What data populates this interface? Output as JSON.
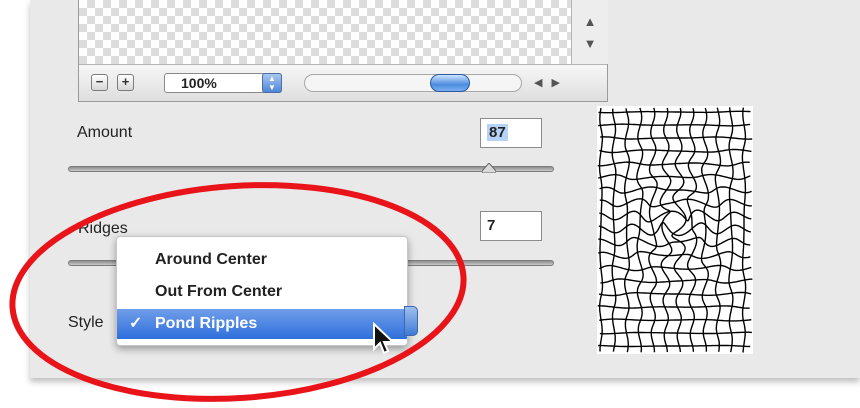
{
  "preview": {
    "zoom_value": "100%",
    "zoom_out_label": "−",
    "zoom_in_label": "+",
    "scroll_up_icon": "▲",
    "scroll_down_icon": "▼",
    "scroll_left_icon": "◀",
    "scroll_right_icon": "▶"
  },
  "controls": {
    "amount": {
      "label": "Amount",
      "value": "87",
      "slider_fraction": 0.87
    },
    "ridges": {
      "label": "Ridges",
      "value": "7"
    },
    "style": {
      "label": "Style"
    }
  },
  "style_menu": {
    "options": [
      "Around Center",
      "Out From Center",
      "Pond Ripples"
    ],
    "selected": "Pond Ripples",
    "check_icon": "✓"
  },
  "colors": {
    "selection": "#2f6fdc",
    "annotation": "#e8141a"
  }
}
